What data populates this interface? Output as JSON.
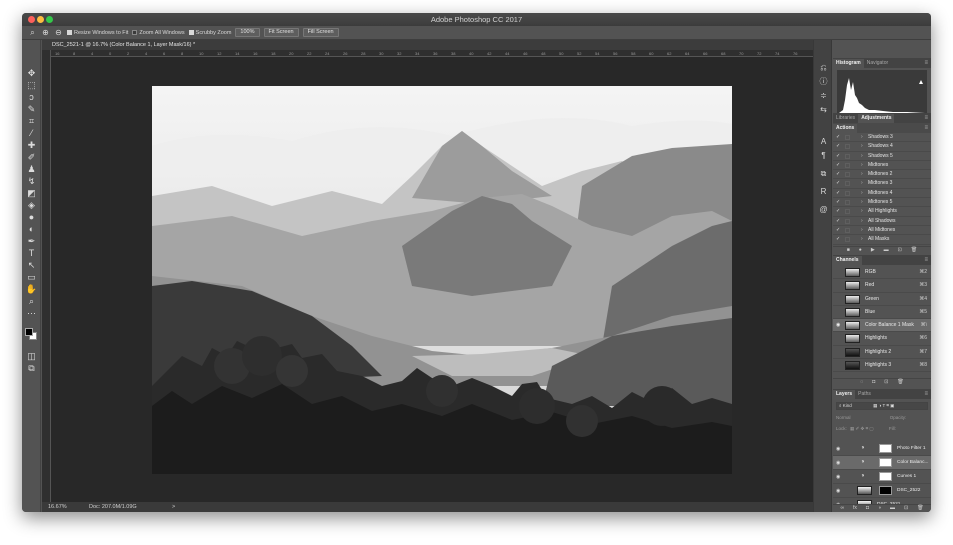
{
  "window": {
    "title": "Adobe Photoshop CC 2017"
  },
  "options_bar": {
    "resize_windows_label": "Resize Windows to Fit",
    "zoom_all_label": "Zoom All Windows",
    "scrubby_zoom_label": "Scrubby Zoom",
    "zoom_100": "100%",
    "fit_screen": "Fit Screen",
    "fill_screen": "Fill Screen"
  },
  "document": {
    "tab_title": "DSC_2521-1 @ 16.7% (Color Balance 1, Layer Mask/16) *",
    "ruler_labels": [
      "16",
      "8",
      "4",
      "0",
      "2",
      "4",
      "6",
      "8",
      "10",
      "12",
      "14",
      "16",
      "18",
      "20",
      "22",
      "24",
      "26",
      "28",
      "30",
      "32",
      "34",
      "36",
      "38",
      "40",
      "42",
      "44",
      "46",
      "48",
      "50",
      "52",
      "54",
      "56",
      "58",
      "60",
      "62",
      "64",
      "66",
      "68",
      "70",
      "72",
      "74",
      "76"
    ],
    "status_zoom": "16.67%",
    "status_doc": "Doc: 207.0M/1.09G",
    "status_arrow": ">"
  },
  "histogram_panel": {
    "tabs": [
      "Histogram",
      "Navigator"
    ]
  },
  "actions_panel": {
    "tabs": [
      "Libraries",
      "Adjustments"
    ],
    "header": "Actions",
    "items": [
      "Shadows 3",
      "Shadows 4",
      "Shadows 5",
      "Midtones",
      "Midtones 2",
      "Midtones 3",
      "Midtones 4",
      "Midtones 5",
      "All Highlights",
      "All Shadows",
      "All Midtones",
      "All Masks"
    ]
  },
  "channels_panel": {
    "header": "Channels",
    "items": [
      {
        "label": "RGB",
        "shortcut": "⌘2"
      },
      {
        "label": "Red",
        "shortcut": "⌘3"
      },
      {
        "label": "Green",
        "shortcut": "⌘4"
      },
      {
        "label": "Blue",
        "shortcut": "⌘5"
      },
      {
        "label": "Color Balance 1 Mask",
        "shortcut": "⌘\\"
      },
      {
        "label": "Highlights",
        "shortcut": "⌘6"
      },
      {
        "label": "Highlights 2",
        "shortcut": "⌘7"
      },
      {
        "label": "Highlights 3",
        "shortcut": "⌘8"
      }
    ]
  },
  "layers_panel": {
    "tabs": [
      "Layers",
      "Paths"
    ],
    "kind": "Kind",
    "blend_mode": "Normal",
    "opacity": "Opacity:",
    "lock_label": "Lock:",
    "fill": "Fill:",
    "items": [
      {
        "label": "Photo Filter 1",
        "icon": "adjustment-icon"
      },
      {
        "label": "Color Balanc...",
        "icon": "adjustment-icon"
      },
      {
        "label": "Curves 1",
        "icon": "adjustment-icon"
      },
      {
        "label": "DSC_2522",
        "icon": "image-thumb"
      },
      {
        "label": "DSC_2521",
        "icon": "image-thumb"
      }
    ]
  },
  "colors": {
    "foreground": "#000000",
    "background": "#ffffff",
    "ui_dark": "#535353"
  }
}
